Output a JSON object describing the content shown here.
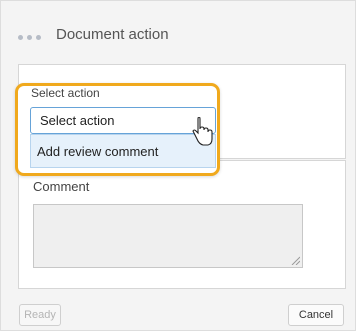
{
  "dialog": {
    "title": "Document action"
  },
  "action_select": {
    "label": "Select action",
    "value": "Select action",
    "options": [
      "Add review comment"
    ]
  },
  "comment": {
    "label": "Comment",
    "value": ""
  },
  "footer": {
    "ready_label": "Ready",
    "cancel_label": "Cancel"
  },
  "colors": {
    "highlight": "#f0a91d",
    "select_border": "#66a3d8",
    "option_bg": "#e6f1fb"
  },
  "icons": {
    "menu": "more-dots-icon",
    "cursor": "hand-pointer-icon",
    "resize": "resize-grip-icon"
  }
}
